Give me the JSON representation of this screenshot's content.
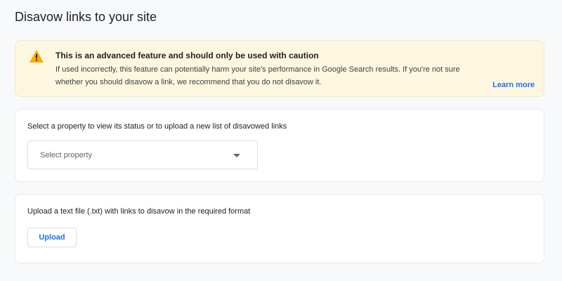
{
  "page": {
    "title": "Disavow links to your site"
  },
  "warning": {
    "icon": "warning-triangle-icon",
    "icon_color": "#f9ab00",
    "title": "This is an advanced feature and should only be used with caution",
    "body": "If used incorrectly, this feature can potentially harm your site's performance in Google Search results. If you're not sure whether you should disavow a link, we recommend that you do not disavow it.",
    "learn_more": "Learn more"
  },
  "property_card": {
    "label": "Select a property to view its status or to upload a new list of disavowed links",
    "select": {
      "placeholder": "Select property",
      "icon": "dropdown-caret-icon"
    }
  },
  "upload_card": {
    "label": "Upload a text file (.txt) with links to disavow in the required format",
    "button_label": "Upload"
  },
  "colors": {
    "background": "#f8f9fa",
    "warning_background": "#fef7e0",
    "accent": "#1a73e8"
  }
}
